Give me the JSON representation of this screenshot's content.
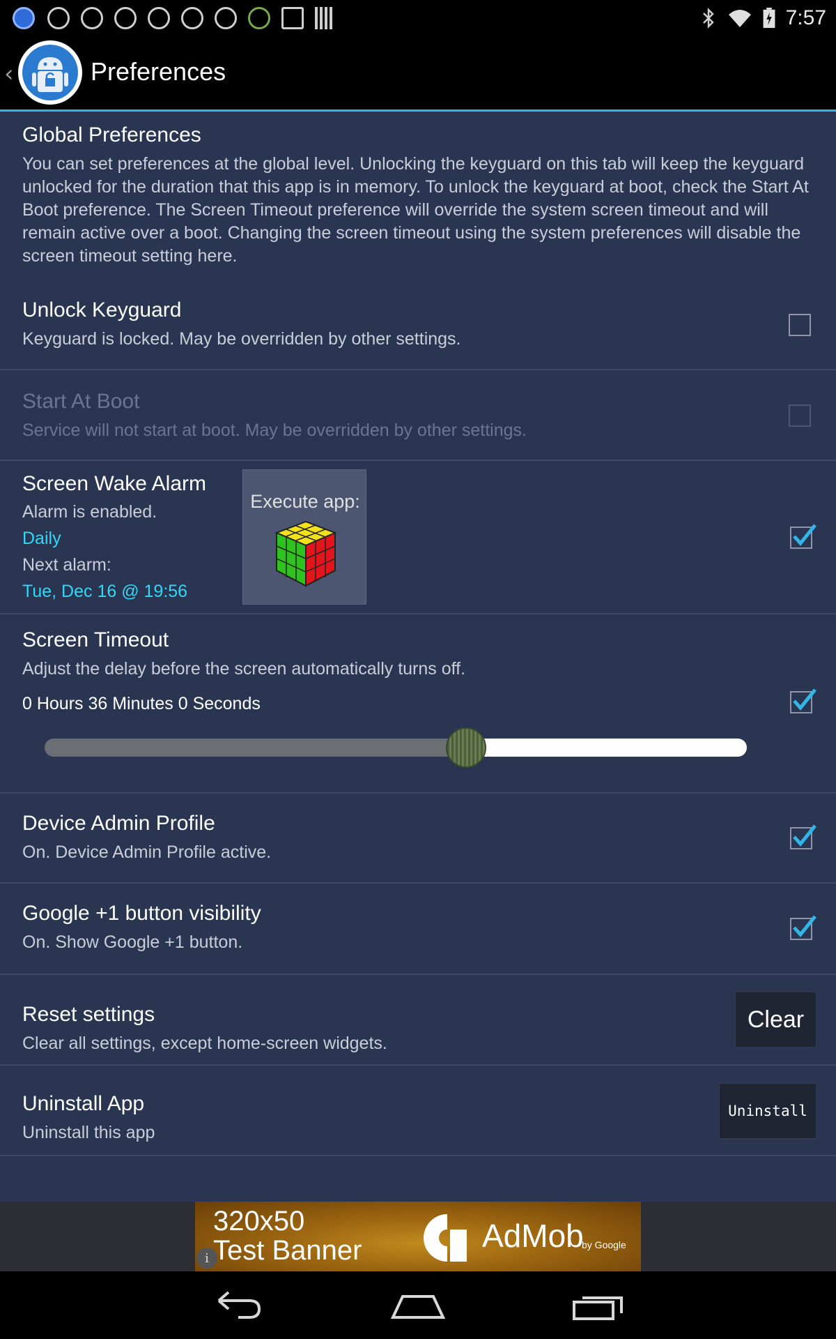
{
  "status_bar": {
    "time": "7:57",
    "left_icons": [
      "bluetooth-icon",
      "c-icon",
      "target-icon",
      "list-icon",
      "crosshair-icon",
      "alarm-icon",
      "lock-icon",
      "android-icon",
      "windows-icon",
      "barcode-icon"
    ],
    "right_icons": [
      "bluetooth-icon",
      "wifi-icon",
      "battery-icon"
    ]
  },
  "action_bar": {
    "title": "Preferences",
    "back_icon": "chevron-left-icon",
    "logo_icon": "android-lock-icon"
  },
  "global": {
    "title": "Global Preferences",
    "description": "You can set preferences at the global level. Unlocking the keyguard on this tab will keep the keyguard unlocked for the duration that this app is in memory. To unlock the keyguard at boot, check the Start At Boot preference. The Screen Timeout preference will override the system screen timeout and will remain active over a boot. Changing the screen timeout using the system preferences will disable the screen timeout setting here."
  },
  "prefs": {
    "unlock_keyguard": {
      "title": "Unlock Keyguard",
      "summary": "Keyguard is locked. May be overridden by other settings.",
      "checked": false
    },
    "start_at_boot": {
      "title": "Start At Boot",
      "summary": "Service will not start at boot. May be overridden by other settings.",
      "checked": false,
      "enabled": false
    },
    "screen_wake_alarm": {
      "title": "Screen Wake Alarm",
      "status": "Alarm is enabled.",
      "frequency": "Daily",
      "next_label": "Next alarm:",
      "next_value": "Tue, Dec 16 @ 19:56",
      "execute_label": "Execute app:",
      "execute_icon": "rubiks-cube-icon",
      "checked": true
    },
    "screen_timeout": {
      "title": "Screen Timeout",
      "summary": "Adjust the delay before the screen automatically turns off.",
      "value_text": "0 Hours 36 Minutes 0 Seconds",
      "slider_fraction": 0.6,
      "checked": true
    },
    "device_admin": {
      "title": "Device Admin Profile",
      "summary": "On. Device Admin Profile active.",
      "checked": true
    },
    "google_plus_one": {
      "title": "Google +1 button visibility",
      "summary": "On. Show Google +1 button.",
      "checked": true
    },
    "reset": {
      "title": "Reset settings",
      "summary": "Clear all settings, except home-screen widgets.",
      "button_label": "Clear"
    },
    "uninstall": {
      "title": "Uninstall App",
      "summary": "Uninstall this app",
      "button_label": "Uninstall"
    }
  },
  "ad": {
    "line1": "320x50",
    "line2": "Test Banner",
    "brand": "AdMob",
    "by": "by Google",
    "info_glyph": "i"
  },
  "nav_bar": {
    "icons": [
      "back-icon",
      "home-icon",
      "recents-icon"
    ]
  },
  "colors": {
    "background": "#2a3552",
    "accent": "#33b5e5",
    "link": "#33d7f5",
    "checkmark": "#33b5e5"
  }
}
